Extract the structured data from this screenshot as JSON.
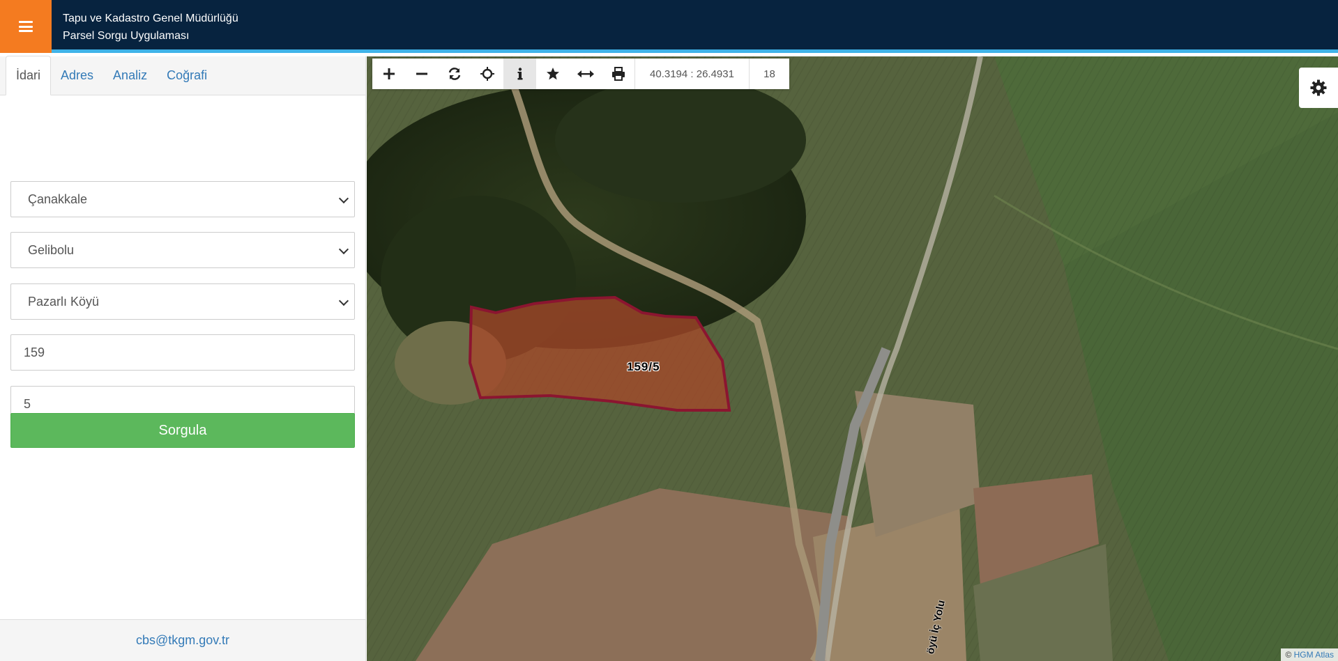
{
  "header": {
    "title_line1": "Tapu ve Kadastro Genel Müdürlüğü",
    "title_line2": "Parsel Sorgu Uygulaması",
    "menu_icon": "hamburger-icon"
  },
  "sidebar": {
    "tabs": [
      {
        "label": "İdari",
        "active": true
      },
      {
        "label": "Adres",
        "active": false
      },
      {
        "label": "Analiz",
        "active": false
      },
      {
        "label": "Coğrafi",
        "active": false
      }
    ],
    "form": {
      "province": "Çanakkale",
      "district": "Gelibolu",
      "neighborhood": "Pazarlı Köyü",
      "block": "159",
      "parcel": "5",
      "submit_label": "Sorgula"
    },
    "footer_email": "cbs@tkgm.gov.tr"
  },
  "map": {
    "toolbar": {
      "buttons": [
        "zoom-in-icon",
        "zoom-out-icon",
        "refresh-icon",
        "locate-icon",
        "info-icon",
        "star-icon",
        "measure-icon",
        "print-icon"
      ],
      "active_button": "info-icon",
      "coordinates": "40.3194 : 26.4931",
      "zoom_level": "18"
    },
    "settings_icon": "gear-icon",
    "parcel_label": "159/5",
    "road_label": "öyü İç Yolu",
    "attribution_prefix": "©",
    "attribution_link": "HGM Atlas",
    "colors": {
      "parcel_stroke": "#8b1530",
      "parcel_fill": "#a8482a",
      "header_bg": "#07233f",
      "accent_orange": "#f47b20",
      "submit_green": "#5cb85c"
    }
  }
}
